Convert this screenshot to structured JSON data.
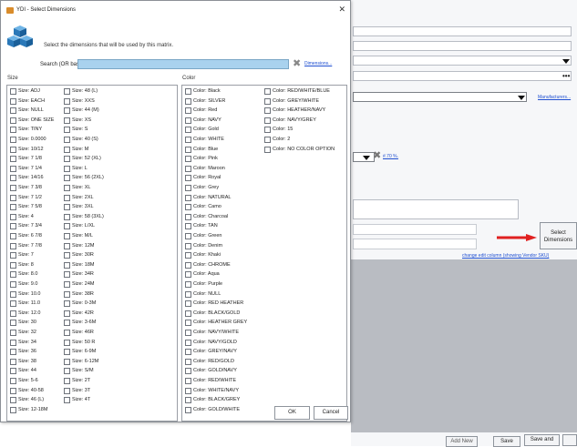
{
  "dialog": {
    "title": "YDI - Select Dimensions",
    "instruction": "Select the dimensions that will be used by this matrix.",
    "search_label": "Search (OR based)",
    "search_value": "",
    "dimensions_link": "Dimensions...",
    "ok_label": "OK",
    "cancel_label": "Cancel"
  },
  "size": {
    "header": "Size",
    "column1": [
      "Size: ADJ",
      "Size: EACH",
      "Size: NULL",
      "Size: ONE SIZE",
      "Size: TINY",
      "Size: 0.0000",
      "Size: 10/12",
      "Size: 7 1/8",
      "Size: 7 1/4",
      "Size: 14/16",
      "Size: 7 3/8",
      "Size: 7 1/2",
      "Size: 7 5/8",
      "Size: 4",
      "Size: 7 3/4",
      "Size: 6 7/8",
      "Size: 7 7/8",
      "Size: 7",
      "Size: 8",
      "Size: 8.0",
      "Size: 9.0",
      "Size: 10.0",
      "Size: 11.0",
      "Size: 12.0",
      "Size: 30",
      "Size: 32",
      "Size: 34",
      "Size: 36",
      "Size: 38",
      "Size: 44",
      "Size: 5-6",
      "Size: 40-58",
      "Size: 46 (L)",
      "Size: 12-18M"
    ],
    "column2": [
      "Size: 48 (L)",
      "Size: XXS",
      "Size: 44 (M)",
      "Size: XS",
      "Size: S",
      "Size: 40 (S)",
      "Size: M",
      "Size: 52 (XL)",
      "Size: L",
      "Size: 56 (2XL)",
      "Size: XL",
      "Size: 2XL",
      "Size: 3XL",
      "Size: 58 (3XL)",
      "Size: L/XL",
      "Size: M/L",
      "Size: 12M",
      "Size: 30R",
      "Size: 18M",
      "Size: 34R",
      "Size: 24M",
      "Size: 38R",
      "Size: 0-3M",
      "Size: 42R",
      "Size: 3-6M",
      "Size: 46R",
      "Size: 50 R",
      "Size: 6-9M",
      "Size: 6-12M",
      "Size: S/M",
      "Size: 2T",
      "Size: 3T",
      "Size: 4T"
    ]
  },
  "color": {
    "header": "Color",
    "column1": [
      "Color: Black",
      "Color: SILVER",
      "Color: Red",
      "Color: NAVY",
      "Color: Gold",
      "Color: WHITE",
      "Color: Blue",
      "Color: Pink",
      "Color: Maroon",
      "Color: Royal",
      "Color: Grey",
      "Color: NATURAL",
      "Color: Camo",
      "Color: Charcoal",
      "Color: TAN",
      "Color: Green",
      "Color: Denim",
      "Color: Khaki",
      "Color: CHROME",
      "Color: Aqua",
      "Color: Purple",
      "Color: NULL",
      "Color: RED HEATHER",
      "Color: BLACK/GOLD",
      "Color: HEATHER GREY",
      "Color: NAVY/WHITE",
      "Color: NAVY/GOLD",
      "Color: GREY/NAVY",
      "Color: RED/GOLD",
      "Color: GOLD/NAVY",
      "Color: RED/WHITE",
      "Color: WHITE/NAVY",
      "Color: BLACK/GREY",
      "Color: GOLD/WHITE"
    ],
    "column2": [
      "Color: RED/WHITE/BLUE",
      "Color: GREY/WHITE",
      "Color: HEATHER/NAVY",
      "Color: NAVY/GREY",
      "Color: 15",
      "Color: 2",
      "Color: NO COLOR OPTION"
    ]
  },
  "background": {
    "password_mask": "•••",
    "manufacturers_link": "Manufacturers...",
    "percent_link": "#.70 %.",
    "select_dimensions_line1": "Select",
    "select_dimensions_line2": "Dimensions",
    "change_edit_column_link": "change edit column (showing Vendor SKU)",
    "add_new_label": "Add New",
    "save_label": "Save",
    "save_and_label": "Save and",
    "accent_red": "#e02020"
  }
}
